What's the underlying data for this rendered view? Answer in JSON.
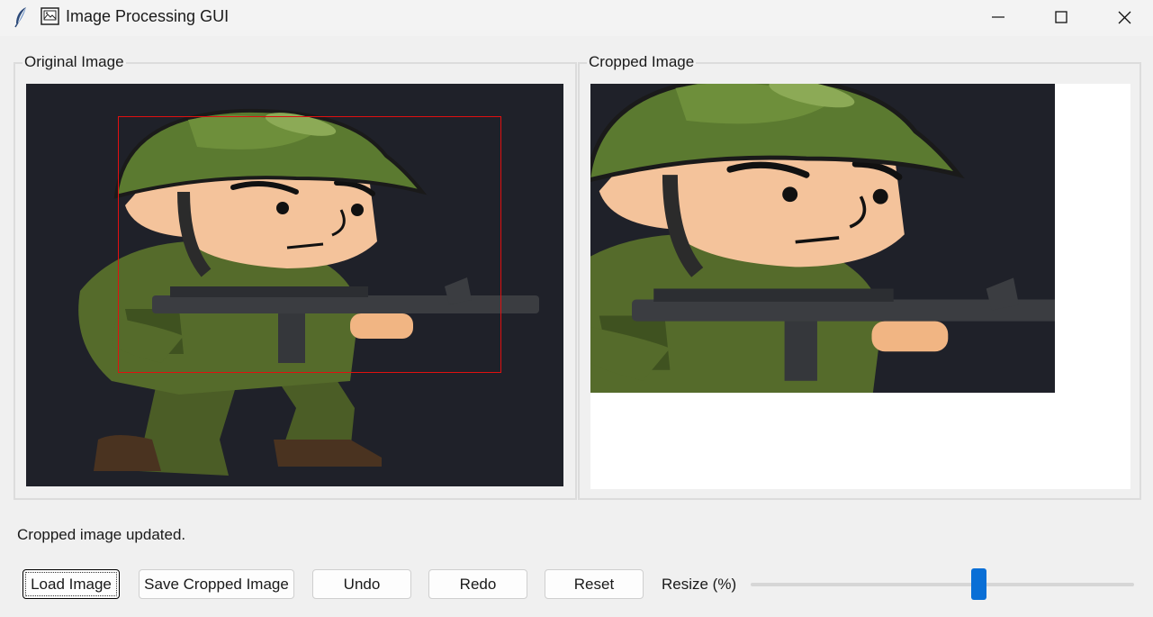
{
  "window": {
    "title": "Image Processing GUI"
  },
  "panels": {
    "original_title": "Original Image",
    "cropped_title": "Cropped Image"
  },
  "status_text": "Cropped image updated.",
  "toolbar": {
    "load_label": "Load Image",
    "save_label": "Save Cropped Image",
    "undo_label": "Undo",
    "redo_label": "Redo",
    "reset_label": "Reset",
    "resize_label": "Resize (%)",
    "resize_value_fraction": 0.6
  },
  "colors": {
    "canvas_bg": "#1f2129",
    "selection": "#e01010",
    "slider_accent": "#0a6fd6"
  },
  "icons": [
    "feather-icon",
    "image-doc-icon",
    "minimize-icon",
    "maximize-icon",
    "close-icon"
  ]
}
